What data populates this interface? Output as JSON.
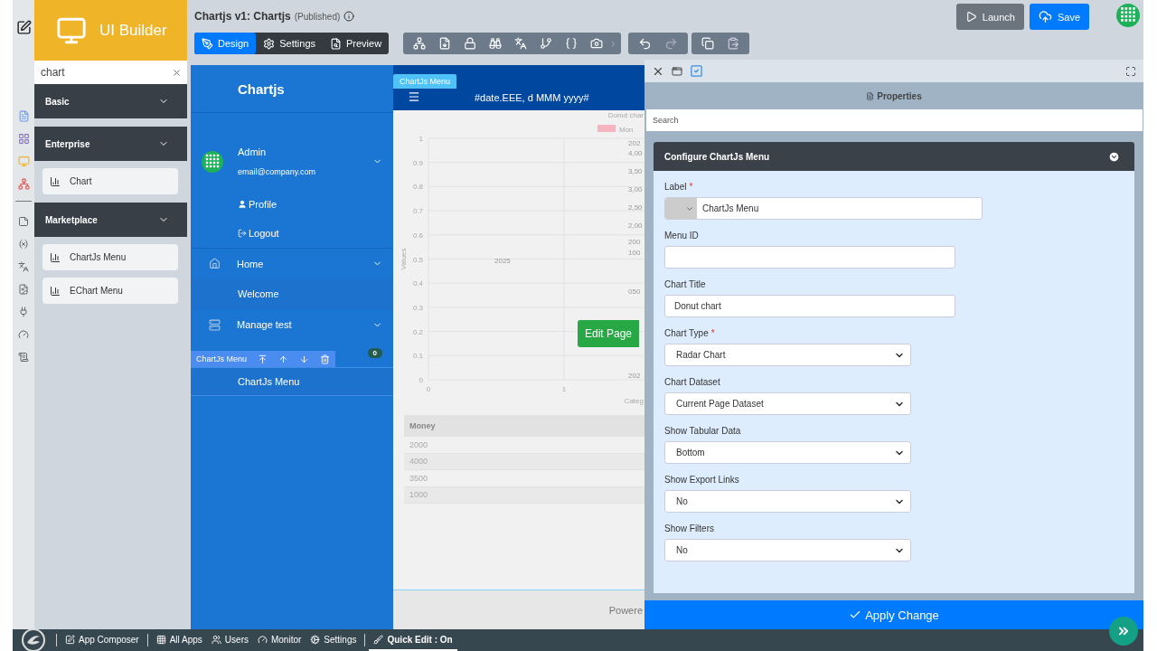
{
  "sidebar": {
    "logo": "UI Builder",
    "search": {
      "value": "chart"
    },
    "sections": [
      {
        "title": "Basic"
      },
      {
        "title": "Enterprise",
        "items": [
          "Chart"
        ]
      },
      {
        "title": "Marketplace",
        "items": [
          "ChartJs Menu",
          "EChart Menu"
        ]
      }
    ]
  },
  "header": {
    "title": "Chartjs v1: Chartjs",
    "status": "(Published)",
    "tabs": [
      {
        "label": "Design",
        "selected": true
      },
      {
        "label": "Settings",
        "selected": false
      },
      {
        "label": "Preview",
        "selected": false
      }
    ],
    "buttons": [
      {
        "label": "Launch",
        "kind": "secondary"
      },
      {
        "label": "Save",
        "kind": "primary"
      }
    ]
  },
  "preview": {
    "brand": "Chartjs",
    "user": {
      "name": "Admin",
      "email": "email@company.com"
    },
    "user_links": [
      "Profile",
      "Logout"
    ],
    "nav": [
      {
        "label": "Home",
        "kind": "group"
      },
      {
        "label": "Welcome",
        "kind": "child"
      },
      {
        "label": "Manage test",
        "kind": "group"
      }
    ],
    "component_tag": "ChartJs Menu",
    "badge": "0",
    "menu_item": "ChartJs Menu",
    "chart_tag": "ChartJs Menu",
    "date_text": "#date.EEE, d MMM yyyy#",
    "chart_data": {
      "type": "line",
      "title": "Donut char",
      "xlabel": "Categ",
      "ylabel": "Values",
      "xticks": [
        0,
        1
      ],
      "yticks": [
        0,
        0.1,
        0.2,
        0.3,
        0.4,
        0.5,
        0.6,
        0.7,
        0.8,
        0.9,
        1
      ],
      "xlim": [
        0,
        1.59
      ],
      "ylim": [
        0,
        1
      ],
      "grid": true
    },
    "radar_labels": [
      "2025",
      "202",
      "4,00",
      "3,50",
      "3,00",
      "2,50",
      "2,00",
      "200",
      "100",
      "050",
      "202"
    ],
    "legend": [
      {
        "label": "Mon",
        "color": "#f4b4c0"
      }
    ],
    "edit_button": "Edit Page",
    "table": {
      "columns": [
        "Money"
      ],
      "rows": [
        "2000",
        "4000",
        "3500",
        "1000"
      ]
    },
    "footer": "Powere"
  },
  "properties": {
    "title": "Properties",
    "required_mark": "*",
    "search": {
      "placeholder": "Search"
    },
    "section": "Configure ChartJs Menu",
    "fields": [
      {
        "label": "Label",
        "required": true,
        "kind": "icon-text",
        "value": "ChartJs Menu"
      },
      {
        "label": "Menu ID",
        "required": false,
        "kind": "text"
      },
      {
        "label": "Chart Title",
        "required": false,
        "kind": "text",
        "value": "Donut chart"
      },
      {
        "label": "Chart Type",
        "required": true,
        "kind": "select",
        "value": "Radar Chart"
      },
      {
        "label": "Chart Dataset",
        "required": false,
        "kind": "select",
        "value": "Current Page Dataset"
      },
      {
        "label": "Show Tabular Data",
        "required": false,
        "kind": "select",
        "value": "Bottom"
      },
      {
        "label": "Show Export Links",
        "required": false,
        "kind": "select",
        "value": "No"
      },
      {
        "label": "Show Filters",
        "required": false,
        "kind": "select",
        "value": "No"
      }
    ],
    "apply": "Apply Change"
  },
  "taskbar": {
    "items": [
      {
        "label": "App Composer",
        "selected": false
      },
      {
        "label": "All Apps",
        "selected": false
      },
      {
        "label": "Users",
        "selected": false
      },
      {
        "label": "Monitor",
        "selected": false
      },
      {
        "label": "Settings",
        "selected": false
      },
      {
        "label": "Quick Edit : On",
        "selected": true
      }
    ]
  }
}
